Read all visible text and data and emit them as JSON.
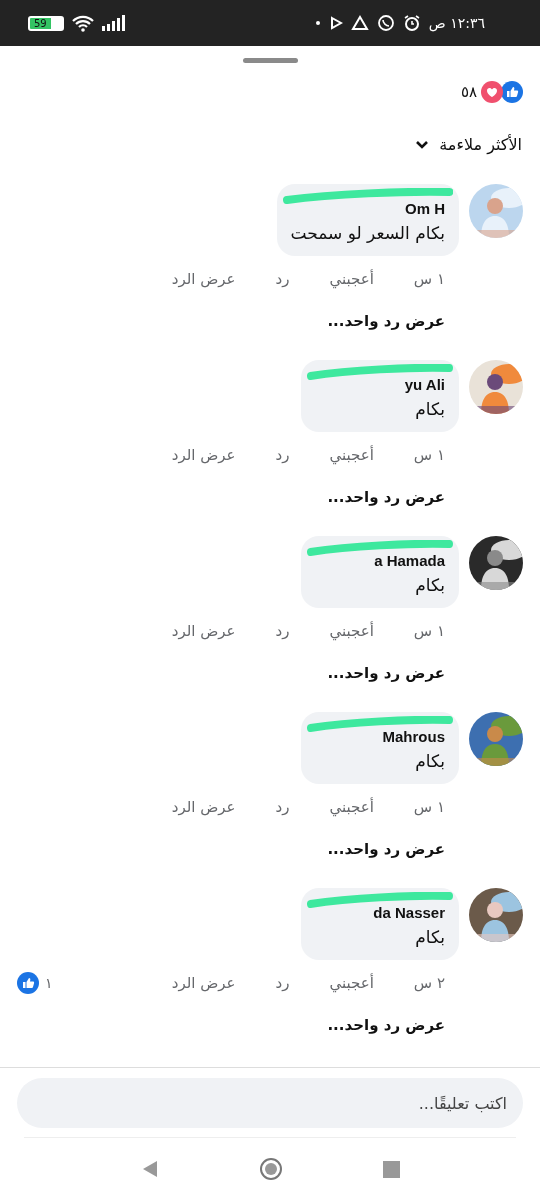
{
  "status_bar": {
    "time": "١٢:٣٦ ص",
    "battery": "59"
  },
  "reactions": {
    "count": "٥٨"
  },
  "sort": {
    "label": "الأكثر ملاءمة"
  },
  "comments": [
    {
      "name": "Om H",
      "redacted": true,
      "text": "بكام السعر لو سمحت",
      "time": "١ س",
      "like": "أعجبني",
      "reply": "رد",
      "see_reply": "عرض الرد",
      "view_replies": "عرض رد واحد..."
    },
    {
      "name": "yu Ali",
      "redacted": true,
      "text": "بكام",
      "time": "١ س",
      "like": "أعجبني",
      "reply": "رد",
      "see_reply": "عرض الرد",
      "view_replies": "عرض رد واحد..."
    },
    {
      "name": "a Hamada",
      "redacted": true,
      "text": "بكام",
      "time": "١ س",
      "like": "أعجبني",
      "reply": "رد",
      "see_reply": "عرض الرد",
      "view_replies": "عرض رد واحد..."
    },
    {
      "name": "Mahrous",
      "redacted": true,
      "text": "بكام",
      "time": "١ س",
      "like": "أعجبني",
      "reply": "رد",
      "see_reply": "عرض الرد",
      "view_replies": "عرض رد واحد..."
    },
    {
      "name": "da Nasser",
      "redacted": true,
      "text": "بكام",
      "time": "٢ س",
      "like": "أعجبني",
      "reply": "رد",
      "see_reply": "عرض الرد",
      "view_replies": "عرض رد واحد...",
      "reaction_count": "١"
    }
  ],
  "composer": {
    "placeholder": "اكتب تعليقًا..."
  }
}
